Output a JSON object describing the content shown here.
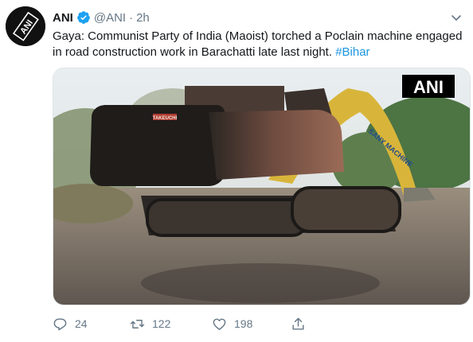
{
  "account": {
    "name": "ANI",
    "handle": "@ANI",
    "separator": "·",
    "time": "2h",
    "avatar_text": "ANI"
  },
  "tweet": {
    "text": "Gaya: Communist Party of India (Maoist) torched a Poclain machine engaged in road construction work in Barachatti late last night.",
    "hashtag": "#Bihar"
  },
  "media": {
    "watermark": "ANI",
    "machine_brand": "TAKEUCHI",
    "boom_text": "SANY MACHINE"
  },
  "actions": {
    "reply_count": "24",
    "retweet_count": "122",
    "like_count": "198"
  },
  "colors": {
    "verified": "#1da1f2",
    "hashtag": "#1b95e0",
    "muted": "#657786"
  },
  "icons": [
    "verified-badge-icon",
    "chevron-down-icon",
    "reply-icon",
    "retweet-icon",
    "like-icon",
    "share-icon"
  ]
}
